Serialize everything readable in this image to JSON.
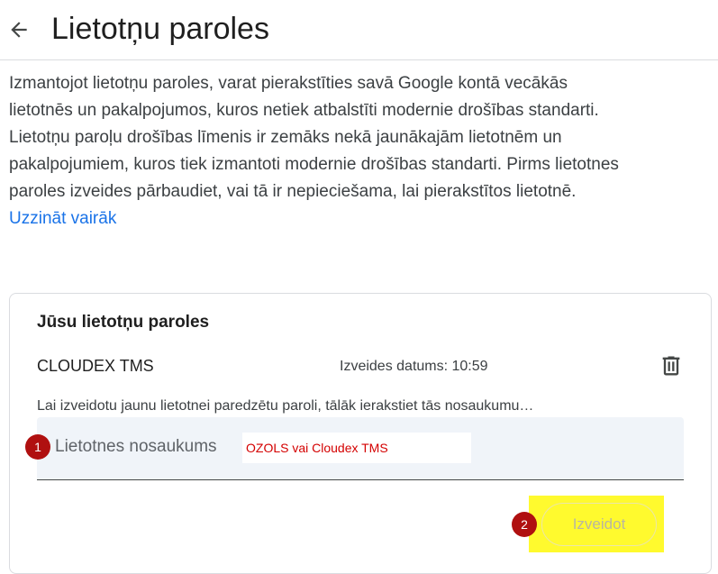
{
  "header": {
    "title": "Lietotņu paroles",
    "back_icon": "arrow-back-icon"
  },
  "intro": {
    "paragraph1": "Izmantojot lietotņu paroles, varat pierakstīties savā Google kontā vecākās lietotnēs un pakalpojumos, kuros netiek atbalstīti modernie drošības standarti.",
    "paragraph2": "Lietotņu paroļu drošības līmenis ir zemāks nekā jaunākajām lietotnēm un pakalpojumiem, kuros tiek izmantoti modernie drošības standarti. Pirms lietotnes paroles izveides pārbaudiet, vai tā ir nepieciešama, lai pierakstītos lietotnē.",
    "learn_more": "Uzzināt vairāk"
  },
  "card": {
    "title": "Jūsu lietotņu paroles",
    "passwords": [
      {
        "name": "CLOUDEX TMS",
        "created": "Izveides datums: 10:59"
      }
    ],
    "hint": "Lai izveidotu jaunu lietotnei paredzētu paroli, tālāk ierakstiet tās nosaukumu…",
    "field_label": "Lietotnes nosaukums",
    "field_value": "OZOLS vai Cloudex TMS",
    "create_button": "Izveidot"
  },
  "annotations": {
    "step1": "1",
    "step2": "2"
  },
  "colors": {
    "accent": "#1a73e8",
    "badge": "#b01010",
    "highlight": "#fffa2e",
    "annotation_text": "#d40000"
  }
}
